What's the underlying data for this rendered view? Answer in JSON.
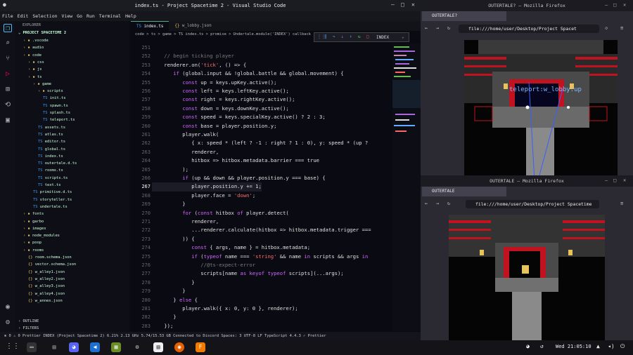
{
  "vscode": {
    "title": "index.ts - Project Spacetime 2 - Visual Studio Code",
    "menu": [
      "File",
      "Edit",
      "Selection",
      "View",
      "Go",
      "Run",
      "Terminal",
      "Help"
    ],
    "sidebar": {
      "header": "EXPLORER",
      "project": "PROJECT SPACETIME 2",
      "items": [
        {
          "label": "vscode",
          "kind": "folder",
          "depth": 1,
          "name_prefix": "."
        },
        {
          "label": "audio",
          "kind": "folder",
          "depth": 1
        },
        {
          "label": "code",
          "kind": "folder",
          "depth": 1
        },
        {
          "label": "css",
          "kind": "folder",
          "depth": 2
        },
        {
          "label": "js",
          "kind": "folder",
          "depth": 2
        },
        {
          "label": "ts",
          "kind": "folder",
          "depth": 2
        },
        {
          "label": "game",
          "kind": "folder",
          "depth": 3
        },
        {
          "label": "scripts",
          "kind": "folder",
          "depth": 4
        },
        {
          "label": "init.ts",
          "kind": "ts",
          "depth": 5
        },
        {
          "label": "spawn.ts",
          "kind": "ts",
          "depth": 5
        },
        {
          "label": "splash.ts",
          "kind": "ts",
          "depth": 5
        },
        {
          "label": "teleport.ts",
          "kind": "ts",
          "depth": 5
        },
        {
          "label": "assets.ts",
          "kind": "ts",
          "depth": 4
        },
        {
          "label": "atlas.ts",
          "kind": "ts",
          "depth": 4
        },
        {
          "label": "editor.ts",
          "kind": "ts",
          "depth": 4
        },
        {
          "label": "global.ts",
          "kind": "ts",
          "depth": 4
        },
        {
          "label": "index.ts",
          "kind": "ts",
          "depth": 4
        },
        {
          "label": "outertale.d.ts",
          "kind": "ts",
          "depth": 4
        },
        {
          "label": "rooms.ts",
          "kind": "ts",
          "depth": 4
        },
        {
          "label": "scripts.ts",
          "kind": "ts",
          "depth": 4
        },
        {
          "label": "text.ts",
          "kind": "ts",
          "depth": 4
        },
        {
          "label": "primitive.d.ts",
          "kind": "ts",
          "depth": 3
        },
        {
          "label": "storyteller.ts",
          "kind": "ts",
          "depth": 3
        },
        {
          "label": "undertale.ts",
          "kind": "ts",
          "depth": 3
        },
        {
          "label": "fonts",
          "kind": "folder",
          "depth": 1
        },
        {
          "label": "garbo",
          "kind": "folder",
          "depth": 1
        },
        {
          "label": "images",
          "kind": "folder",
          "depth": 1
        },
        {
          "label": "node_modules",
          "kind": "folder",
          "depth": 1
        },
        {
          "label": "poop",
          "kind": "folder",
          "depth": 1
        },
        {
          "label": "rooms",
          "kind": "folder",
          "depth": 1
        },
        {
          "label": "room.schema.json",
          "kind": "json",
          "depth": 2
        },
        {
          "label": "vector.schema.json",
          "kind": "json",
          "depth": 2
        },
        {
          "label": "w_alley1.json",
          "kind": "json",
          "depth": 2
        },
        {
          "label": "w_alley2.json",
          "kind": "json",
          "depth": 2
        },
        {
          "label": "w_alley3.json",
          "kind": "json",
          "depth": 2
        },
        {
          "label": "w_alley4.json",
          "kind": "json",
          "depth": 2
        },
        {
          "label": "w_annex.json",
          "kind": "json",
          "depth": 2
        }
      ],
      "outline": "OUTLINE",
      "filters": "FILTERS"
    },
    "tabs": [
      {
        "label": "index.ts",
        "icon": "TS",
        "active": true
      },
      {
        "label": "w_lobby.json",
        "icon": "{}",
        "active": false
      }
    ],
    "breadcrumb": "code > ts > game > TS index.ts > promise > Undertale.module('INDEX') callback",
    "debug_label": "INDEX",
    "code_lines": [
      {
        "n": "251",
        "t": ""
      },
      {
        "n": "252",
        "t": "    // begin ticking player"
      },
      {
        "n": "253",
        "t": "    renderer.on('tick', () => {"
      },
      {
        "n": "254",
        "t": "       if (global.input && !global.battle && global.movement) {"
      },
      {
        "n": "255",
        "t": "          const up = keys.upKey.active();"
      },
      {
        "n": "256",
        "t": "          const left = keys.leftKey.active();"
      },
      {
        "n": "257",
        "t": "          const right = keys.rightKey.active();"
      },
      {
        "n": "258",
        "t": "          const down = keys.downKey.active();"
      },
      {
        "n": "259",
        "t": "          const speed = keys.specialKey.active() ? 2 : 3;"
      },
      {
        "n": "260",
        "t": "          const base = player.position.y;"
      },
      {
        "n": "261",
        "t": "          player.walk("
      },
      {
        "n": "262",
        "t": "             { x: speed * (left ? -1 : right ? 1 : 0), y: speed * (up ?"
      },
      {
        "n": "263",
        "t": "             renderer,"
      },
      {
        "n": "264",
        "t": "             hitbox => hitbox.metadata.barrier === true"
      },
      {
        "n": "265",
        "t": "          );"
      },
      {
        "n": "266",
        "t": "          if (up && down && player.position.y === base) {"
      },
      {
        "n": "267",
        "t": "             player.position.y += 1;"
      },
      {
        "n": "268",
        "t": "             player.face = 'down';"
      },
      {
        "n": "269",
        "t": "          }"
      },
      {
        "n": "270",
        "t": "          for (const hitbox of player.detect("
      },
      {
        "n": "271",
        "t": "             renderer,"
      },
      {
        "n": "272",
        "t": "             ...renderer.calculate(hitbox => hitbox.metadata.trigger ==="
      },
      {
        "n": "273",
        "t": "          )) {"
      },
      {
        "n": "274",
        "t": "             const { args, name } = hitbox.metadata;"
      },
      {
        "n": "275",
        "t": "             if (typeof name === 'string' && name in scripts && args in"
      },
      {
        "n": "276",
        "t": "                //@ts-expect-error"
      },
      {
        "n": "277",
        "t": "                scripts[name as keyof typeof scripts](...args);"
      },
      {
        "n": "278",
        "t": "             }"
      },
      {
        "n": "279",
        "t": "          }"
      },
      {
        "n": "280",
        "t": "       } else {"
      },
      {
        "n": "281",
        "t": "          player.walk({ x: 0, y: 0 }, renderer);"
      },
      {
        "n": "282",
        "t": "       }"
      },
      {
        "n": "283",
        "t": "    });"
      }
    ],
    "status": "⊗ 0 ⚠ 0   Prettier   INDEX (Project Spacetime 2)   6.21%   2.13 GHz   5.74/15.53 GB   Connected to Discord      Spaces: 3   UTF-8   LF   TypeScript   4.4.3   ✓ Prettier"
  },
  "firefox_top": {
    "title": "OUTERTALE? — Mozilla Firefox",
    "tab": "OUTERTALE?",
    "url": "file:///home/user/Desktop/Project Spacet",
    "overlay_text": "teleport:w_lobby:up"
  },
  "firefox_bottom": {
    "title": "OUTERTALE — Mozilla Firefox",
    "tab": "OUTERTALE",
    "url": "file:///home/user/Desktop/Project Spacetime"
  },
  "taskbar": {
    "clock": "Wed 21:05:10"
  },
  "colors": {
    "accent": "#3a9af0",
    "keyword": "#d267ff",
    "string": "#ff6b6b",
    "number": "#ff4fa0"
  }
}
